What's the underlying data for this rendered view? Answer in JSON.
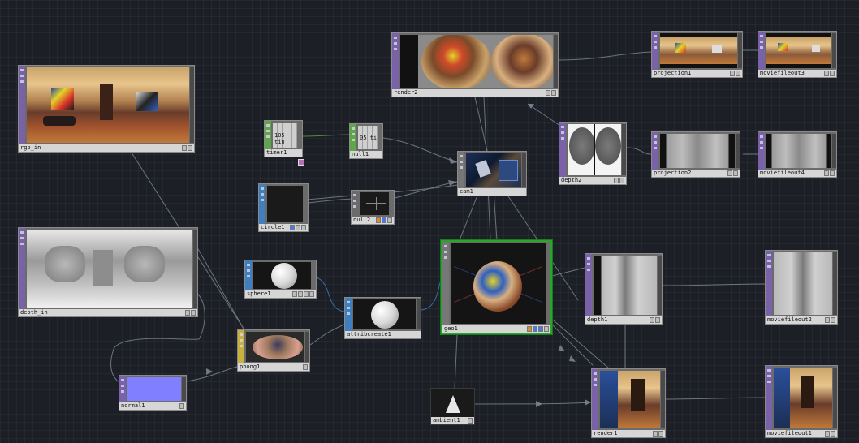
{
  "network": {
    "nodes": {
      "rgb_in": {
        "label": "rgb_in",
        "type": "TOP"
      },
      "depth_in": {
        "label": "depth_in",
        "type": "TOP"
      },
      "timer1": {
        "label": "timer1",
        "type": "CHOP",
        "display": "105 tin"
      },
      "null1": {
        "label": "null1",
        "type": "CHOP",
        "display": "05 ti"
      },
      "circle1": {
        "label": "circle1",
        "type": "SOP"
      },
      "null2": {
        "label": "null2",
        "type": "SOP"
      },
      "cam1": {
        "label": "cam1",
        "type": "COMP"
      },
      "render2": {
        "label": "render2",
        "type": "TOP"
      },
      "projection1": {
        "label": "projection1",
        "type": "TOP"
      },
      "moviefileout3": {
        "label": "moviefileout3",
        "type": "TOP"
      },
      "depth2": {
        "label": "depth2",
        "type": "TOP"
      },
      "projection2": {
        "label": "projection2",
        "type": "TOP"
      },
      "moviefileout4": {
        "label": "moviefileout4",
        "type": "TOP"
      },
      "sphere1": {
        "label": "sphere1",
        "type": "SOP"
      },
      "attribcreate1": {
        "label": "attribcreate1",
        "type": "SOP"
      },
      "geo1": {
        "label": "geo1",
        "type": "COMP"
      },
      "depth1": {
        "label": "depth1",
        "type": "TOP"
      },
      "moviefileout2": {
        "label": "moviefileout2",
        "type": "TOP"
      },
      "phong1": {
        "label": "phong1",
        "type": "MAT"
      },
      "normal1": {
        "label": "normal1",
        "type": "TOP"
      },
      "ambient1": {
        "label": "ambient1",
        "type": "COMP"
      },
      "render1": {
        "label": "render1",
        "type": "TOP"
      },
      "moviefileout1": {
        "label": "moviefileout1",
        "type": "TOP"
      }
    }
  },
  "colors": {
    "background": "#1c2026",
    "top_strip": "#7a62a8",
    "chop_strip": "#5fa54a",
    "sop_strip": "#3f7fc0",
    "mat_strip": "#c8b13d",
    "selected_border": "#27a52c",
    "wire": "#7f8896"
  }
}
